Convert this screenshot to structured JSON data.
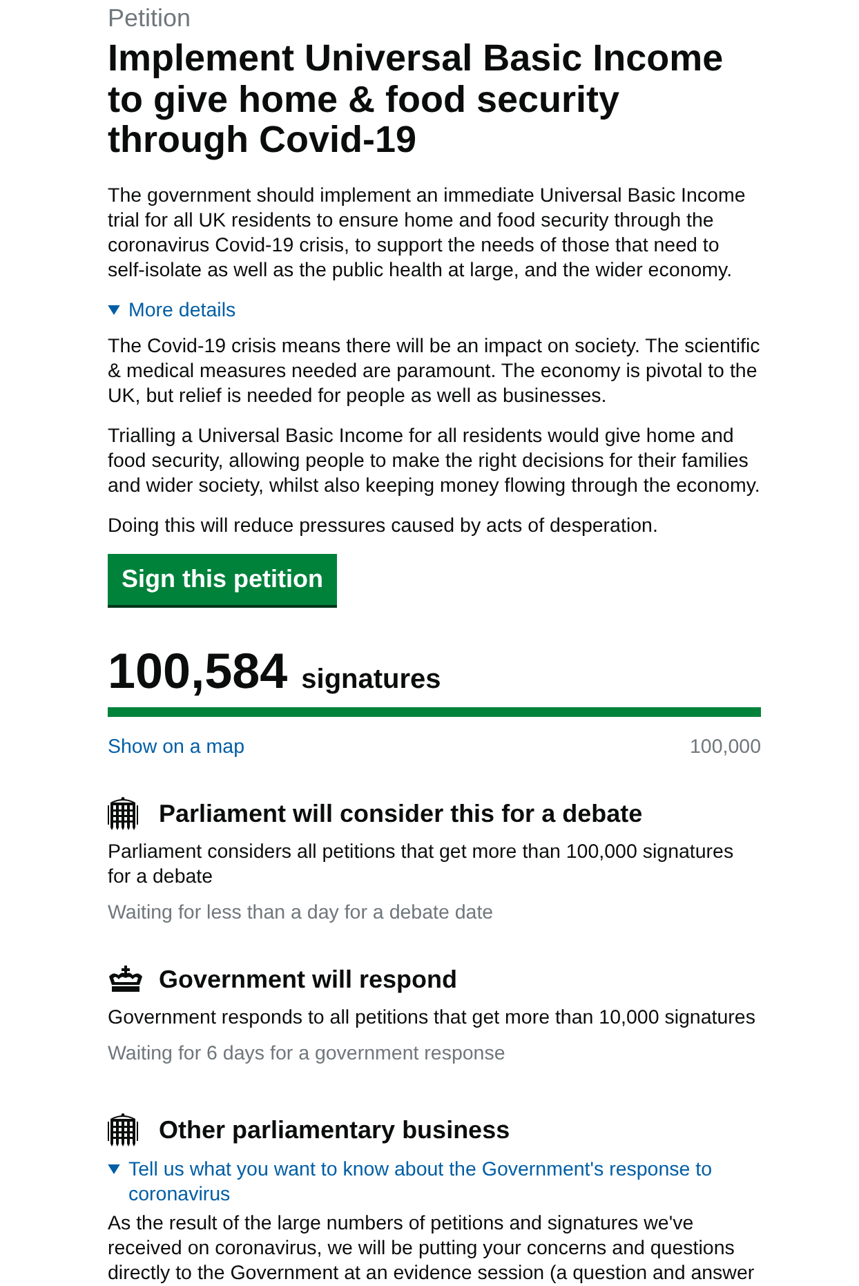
{
  "caption": "Petition",
  "title": "Implement Universal Basic Income to give home & food security through Covid-19",
  "summary": "The government should implement an immediate Universal Basic Income trial for all UK residents to ensure home and food security through the coronavirus Covid-19 crisis, to support the needs of those that need to self-isolate as well as the public health at large, and the wider economy.",
  "details": {
    "summary": "More details",
    "expanded": true,
    "paragraphs": [
      "The Covid-19 crisis means there will be an impact on society. The scientific & medical measures needed are paramount. The economy is pivotal to the UK, but relief is needed for people as well as businesses.",
      "Trialling a Universal Basic Income for all residents would give home and food security, allowing people to make the right decisions for their families and wider society, whilst also keeping money flowing through the economy.",
      "Doing this will reduce pressures caused by acts of desperation."
    ]
  },
  "sign_button": "Sign this petition",
  "signatures": {
    "count": "100,584",
    "unit": "signatures",
    "level": 1,
    "map_link": "Show on a map",
    "target": "100,000"
  },
  "thresholds": [
    {
      "kind": "parliament",
      "heading": "Parliament will consider this for a debate",
      "text": "Parliament considers all petitions that get more than 100,000 signatures for a debate",
      "status": "Waiting for less than a day for a debate date"
    },
    {
      "kind": "government",
      "heading": "Government will respond",
      "text": "Government responds to all petitions that get more than 10,000 signatures",
      "status": "Waiting for 6 days for a government response"
    }
  ],
  "other_business": {
    "kind": "parliament",
    "heading": "Other parliamentary business",
    "details": {
      "summary": "Tell us what you want to know about the Government's response to coronavirus",
      "expanded": true
    },
    "text": "As the result of the large numbers of petitions and signatures we've received on coronavirus, we will be putting your concerns and questions directly to the Government at an evidence session (a question and answer"
  }
}
